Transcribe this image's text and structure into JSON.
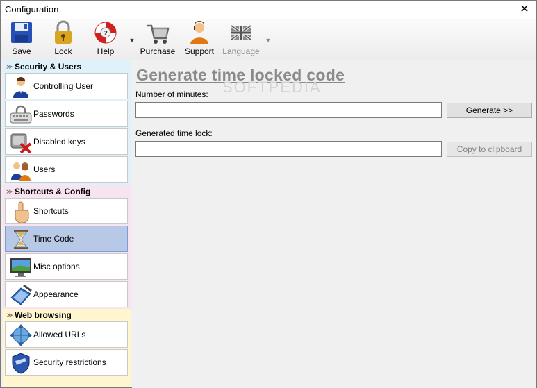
{
  "window": {
    "title": "Configuration",
    "close_glyph": "✕"
  },
  "toolbar": {
    "buttons": [
      {
        "label": "Save",
        "icon": "floppy-disk-icon"
      },
      {
        "label": "Lock",
        "icon": "padlock-icon"
      },
      {
        "label": "Help",
        "icon": "lifebuoy-icon"
      },
      {
        "label": "Purchase",
        "icon": "shopping-cart-icon"
      },
      {
        "label": "Support",
        "icon": "support-person-icon"
      },
      {
        "label": "Language",
        "icon": "uk-flag-icon",
        "disabled": true
      }
    ],
    "dropdown_glyph": "▼"
  },
  "sidebar": {
    "groups": [
      {
        "title": "Security & Users",
        "items": [
          {
            "label": "Controlling User",
            "icon": "user-icon"
          },
          {
            "label": "Passwords",
            "icon": "password-keyboard-icon"
          },
          {
            "label": "Disabled keys",
            "icon": "disabled-keys-icon"
          },
          {
            "label": "Users",
            "icon": "users-icon"
          }
        ]
      },
      {
        "title": "Shortcuts & Config",
        "items": [
          {
            "label": "Shortcuts",
            "icon": "pointing-hand-icon"
          },
          {
            "label": "Time Code",
            "icon": "hourglass-icon",
            "active": true
          },
          {
            "label": "Misc options",
            "icon": "desktop-icon"
          },
          {
            "label": "Appearance",
            "icon": "paint-pen-icon"
          }
        ]
      },
      {
        "title": "Web browsing",
        "items": [
          {
            "label": "Allowed URLs",
            "icon": "globe-arrows-icon"
          },
          {
            "label": "Security restrictions",
            "icon": "shield-icon"
          }
        ]
      }
    ],
    "chevron_glyph": "≫"
  },
  "main": {
    "heading": "Generate time locked code",
    "watermark": "SOFTPEDIA",
    "minutes_label": "Number of minutes:",
    "minutes_value": "",
    "generate_label": "Generate  >>",
    "timelock_label": "Generated time lock:",
    "timelock_value": "",
    "copy_label": "Copy to clipboard"
  },
  "colors": {
    "active_item": "#b8c9e8",
    "heading": "#8a8a8a"
  }
}
